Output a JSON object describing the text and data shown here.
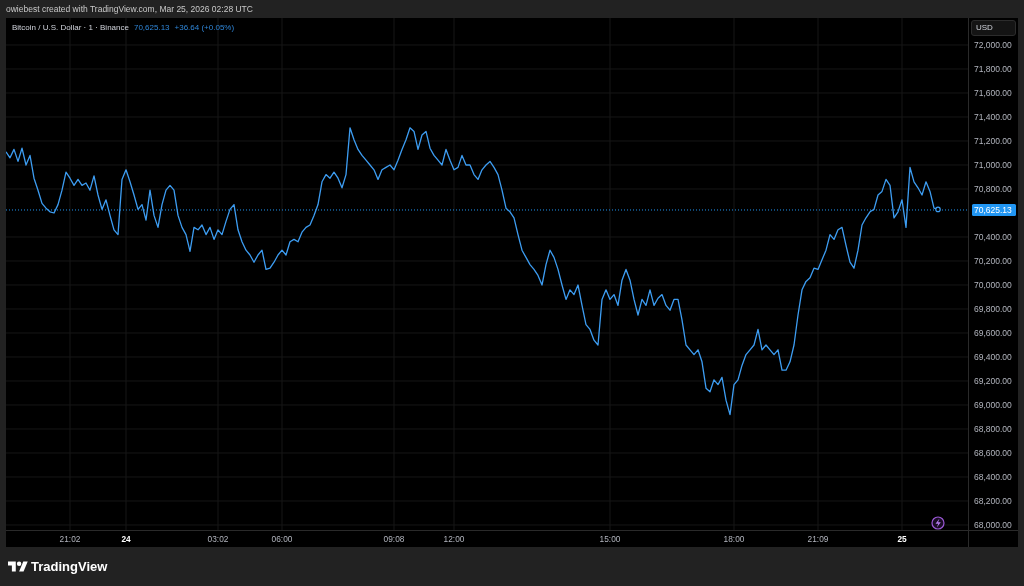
{
  "header": {
    "caption": "owiebest created with TradingView.com, Mar 25, 2026 02:28 UTC"
  },
  "chart": {
    "legend": {
      "symbol": "Bitcoin / U.S. Dollar · 1 · Binance",
      "last": "70,625.13",
      "change": "+36.64 (+0.05%)"
    },
    "currency": "USD",
    "chart_data": {
      "type": "line",
      "grid": true,
      "categories": [
        null,
        null,
        null,
        null,
        null,
        null,
        null,
        null,
        null,
        null,
        null,
        null,
        null,
        null,
        null,
        null,
        "21:02",
        null,
        null,
        null,
        null,
        null,
        null,
        null,
        null,
        null,
        null,
        null,
        null,
        null,
        "24",
        null,
        null,
        null,
        null,
        null,
        null,
        null,
        null,
        null,
        null,
        null,
        null,
        null,
        null,
        null,
        null,
        null,
        null,
        null,
        null,
        null,
        null,
        "03:02",
        null,
        null,
        null,
        null,
        null,
        null,
        null,
        null,
        null,
        null,
        null,
        null,
        null,
        null,
        null,
        "06:00",
        null,
        null,
        null,
        null,
        null,
        null,
        null,
        null,
        null,
        null,
        null,
        null,
        null,
        null,
        null,
        null,
        null,
        null,
        null,
        null,
        null,
        null,
        null,
        null,
        null,
        null,
        null,
        "09:08",
        null,
        null,
        null,
        null,
        null,
        null,
        null,
        null,
        null,
        null,
        null,
        null,
        null,
        null,
        "12:00",
        null,
        null,
        null,
        null,
        null,
        null,
        null,
        null,
        null,
        null,
        null,
        null,
        null,
        null,
        null,
        null,
        null,
        null,
        null,
        null,
        null,
        null,
        null,
        null,
        null,
        null,
        null,
        null,
        null,
        null,
        null,
        null,
        null,
        null,
        null,
        null,
        null,
        null,
        "15:00",
        null,
        null,
        null,
        null,
        null,
        null,
        null,
        null,
        null,
        null,
        null,
        null,
        null,
        null,
        null,
        null,
        null,
        null,
        null,
        null,
        null,
        null,
        null,
        null,
        null,
        null,
        null,
        null,
        null,
        null,
        "18:00",
        null,
        null,
        null,
        null,
        null,
        null,
        null,
        null,
        null,
        null,
        null,
        null,
        null,
        null,
        null,
        null,
        null,
        null,
        null,
        null,
        "21:09",
        null,
        null,
        null,
        null,
        null,
        null,
        null,
        null,
        null,
        null,
        null,
        null,
        null,
        null,
        null,
        null,
        null,
        null,
        null,
        null,
        "25",
        null,
        null,
        null,
        null,
        null,
        null,
        null,
        null,
        null
      ],
      "series": [
        {
          "color": "#3d9df2",
          "values": [
            71110,
            71060,
            71130,
            71030,
            71140,
            71000,
            71080,
            70890,
            70790,
            70680,
            70640,
            70610,
            70600,
            70670,
            70790,
            70940,
            70890,
            70830,
            70880,
            70830,
            70850,
            70790,
            70910,
            70750,
            70630,
            70710,
            70580,
            70460,
            70420,
            70880,
            70960,
            70860,
            70750,
            70630,
            70670,
            70540,
            70790,
            70580,
            70480,
            70670,
            70790,
            70830,
            70790,
            70580,
            70480,
            70420,
            70280,
            70480,
            70460,
            70500,
            70420,
            70480,
            70380,
            70460,
            70420,
            70530,
            70630,
            70670,
            70460,
            70360,
            70290,
            70250,
            70190,
            70250,
            70290,
            70130,
            70140,
            70190,
            70250,
            70290,
            70250,
            70360,
            70380,
            70360,
            70440,
            70480,
            70500,
            70580,
            70670,
            70860,
            70920,
            70890,
            70940,
            70890,
            70810,
            70920,
            71310,
            71210,
            71130,
            71080,
            71040,
            71000,
            70960,
            70880,
            70960,
            70980,
            71000,
            70960,
            71040,
            71130,
            71210,
            71310,
            71280,
            71130,
            71250,
            71280,
            71140,
            71080,
            71040,
            71000,
            71130,
            71040,
            70960,
            70980,
            71080,
            71000,
            71000,
            70920,
            70880,
            70960,
            71000,
            71030,
            70980,
            70920,
            70790,
            70640,
            70610,
            70560,
            70420,
            70290,
            70230,
            70170,
            70130,
            70080,
            70000,
            70170,
            70290,
            70230,
            70130,
            70000,
            69880,
            69960,
            69920,
            70000,
            69830,
            69670,
            69630,
            69540,
            69500,
            69880,
            69960,
            69880,
            69920,
            69830,
            70040,
            70130,
            70040,
            69880,
            69750,
            69880,
            69830,
            69960,
            69830,
            69890,
            69920,
            69830,
            69790,
            69880,
            69880,
            69710,
            69500,
            69460,
            69420,
            69460,
            69360,
            69140,
            69110,
            69210,
            69170,
            69230,
            69040,
            68920,
            69170,
            69210,
            69330,
            69420,
            69460,
            69500,
            69630,
            69460,
            69500,
            69460,
            69420,
            69460,
            69290,
            69290,
            69360,
            69500,
            69750,
            69960,
            70030,
            70060,
            70140,
            70130,
            70210,
            70290,
            70420,
            70380,
            70460,
            70480,
            70330,
            70190,
            70140,
            70290,
            70500,
            70560,
            70610,
            70630,
            70750,
            70780,
            70880,
            70830,
            70560,
            70610,
            70710,
            70480,
            70980,
            70860,
            70810,
            70750,
            70860,
            70780,
            70640,
            70630
          ]
        }
      ],
      "ref_lines": [
        {
          "axis": "y",
          "value": 70625.13,
          "label": "70,625.13",
          "color": "#2196f3"
        }
      ],
      "ylim": [
        67958.33,
        72225
      ],
      "yticks": [
        {
          "value": 72000,
          "label": "72,000.00"
        },
        {
          "value": 71800,
          "label": "71,800.00"
        },
        {
          "value": 71600,
          "label": "71,600.00"
        },
        {
          "value": 71400,
          "label": "71,400.00"
        },
        {
          "value": 71200,
          "label": "71,200.00"
        },
        {
          "value": 71000,
          "label": "71,000.00"
        },
        {
          "value": 70800,
          "label": "70,800.00"
        },
        {
          "value": 70400,
          "label": "70,400.00"
        },
        {
          "value": 70200,
          "label": "70,200.00"
        },
        {
          "value": 70000,
          "label": "70,000.00"
        },
        {
          "value": 69800,
          "label": "69,800.00"
        },
        {
          "value": 69600,
          "label": "69,600.00"
        },
        {
          "value": 69400,
          "label": "69,400.00"
        },
        {
          "value": 69200,
          "label": "69,200.00"
        },
        {
          "value": 69000,
          "label": "69,000.00"
        },
        {
          "value": 68800,
          "label": "68,800.00"
        },
        {
          "value": 68600,
          "label": "68,600.00"
        },
        {
          "value": 68400,
          "label": "68,400.00"
        },
        {
          "value": 68200,
          "label": "68,200.00"
        },
        {
          "value": 68000,
          "label": "68,000.00"
        }
      ]
    }
  },
  "footer": {
    "logo_text": "TradingView"
  }
}
